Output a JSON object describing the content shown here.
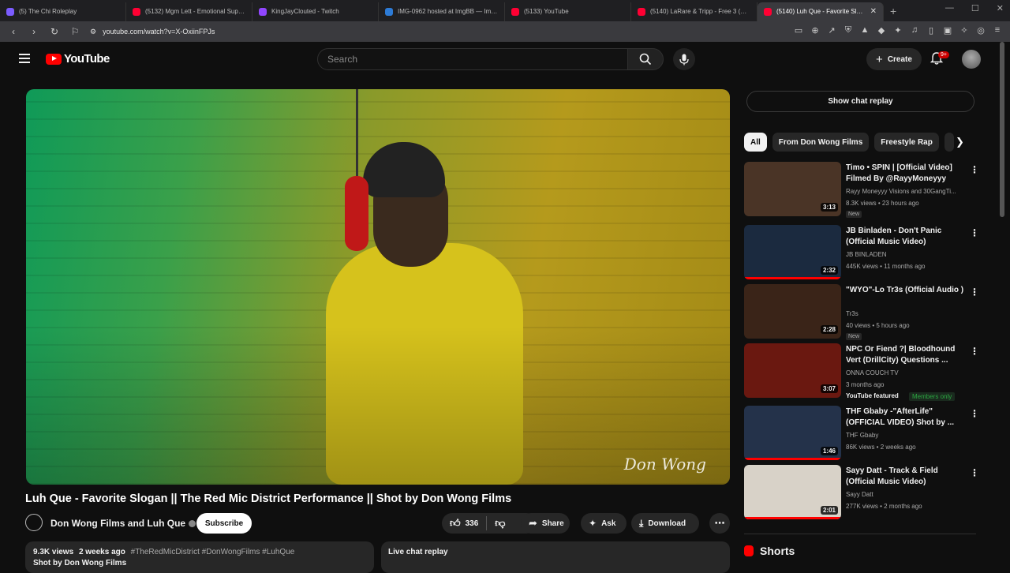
{
  "browser": {
    "tabs": [
      {
        "label": "(5) The Chi Roleplay",
        "color": "#7b5cff"
      },
      {
        "label": "(5132) Mgm Lett - Emotional Support",
        "color": "#ff0033"
      },
      {
        "label": "KingJayClouted - Twitch",
        "color": "#9146ff"
      },
      {
        "label": "IMG-0962 hosted at ImgBB — ImgBB",
        "color": "#2d7bd6"
      },
      {
        "label": "(5133) YouTube",
        "color": "#ff0033"
      },
      {
        "label": "(5140) LaRare & Tripp - Free 3 (Official...",
        "color": "#ff0033"
      },
      {
        "label": "(5140) Luh Que - Favorite Slogan...",
        "color": "#ff0033",
        "active": true
      }
    ],
    "url": "youtube.com/watch?v=X-OxiinFPJs"
  },
  "header": {
    "logo_text": "YouTube",
    "search_placeholder": "Search",
    "create_label": "Create",
    "notifications_badge": "9+"
  },
  "video": {
    "title": "Luh Que - Favorite Slogan || The Red Mic District Performance || Shot by Don Wong Films",
    "watermark": "Don Wong",
    "channel": "Don Wong Films and Luh Que",
    "subscribe_label": "Subscribe",
    "likes": "336",
    "share_label": "Share",
    "ask_label": "Ask",
    "download_label": "Download",
    "views": "9.3K views",
    "age": "2 weeks ago",
    "hashtags": "#TheRedMicDistrict #DonWongFilms #LuhQue",
    "desc_line2": "Shot by Don Wong Films",
    "live_chat": "Live chat replay"
  },
  "sidebar": {
    "show_chat": "Show chat replay",
    "chips": [
      "All",
      "From Don Wong Films",
      "Freestyle Rap"
    ],
    "recommendations": [
      {
        "title": "Timo • SPIN | [Official Video] Filmed By @RayyMoneyyy",
        "channel": "Rayy Moneyyy Visions",
        "channel_extra": "and 30GangTi...",
        "meta": "8.3K views • 23 hours ago",
        "badge": "New",
        "duration": "3:13",
        "thumb_color": "#4a3426",
        "progress": 0
      },
      {
        "title": "JB Binladen - Don't Panic (Official Music Video)",
        "channel": "JB BINLADEN",
        "meta": "445K views • 11 months ago",
        "duration": "2:32",
        "thumb_color": "#1b2a3f",
        "progress": 1.0
      },
      {
        "title": "\"WYO\"-Lo Tr3s (Official Audio )",
        "channel": "Tr3s",
        "meta": "40 views • 5 hours ago",
        "badge": "New",
        "duration": "2:28",
        "thumb_color": "#3a2418",
        "progress": 0
      },
      {
        "title": "NPC Or Fiend ?| Bloodhound Vert (DrillCity) Questions ...",
        "channel": "ONNA COUCH TV",
        "meta": "3 months ago",
        "featured": "YouTube featured",
        "members": "Members only",
        "duration": "3:07",
        "thumb_color": "#6a1810",
        "progress": 0
      },
      {
        "title": "THF Gbaby -\"AfterLife\" (OFFICIAL VIDEO) Shot by ...",
        "channel": "THF Gbaby",
        "meta": "86K views • 2 weeks ago",
        "duration": "1:46",
        "thumb_color": "#24324a",
        "progress": 1.0
      },
      {
        "title": "Sayy Datt - Track & Field (Official Music Video)",
        "channel": "Sayy Datt",
        "meta": "277K views • 2 months ago",
        "duration": "2:01",
        "thumb_color": "#d8d2c8",
        "progress": 1.0
      }
    ],
    "shorts_label": "Shorts"
  }
}
